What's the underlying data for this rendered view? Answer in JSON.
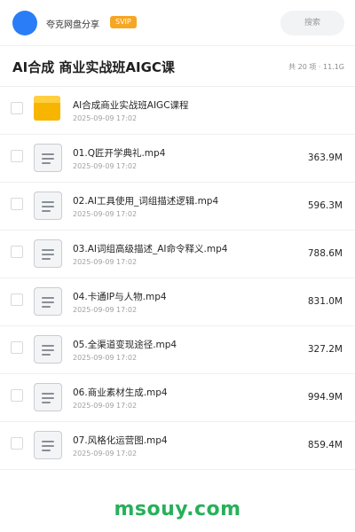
{
  "header": {
    "username": "夸克网盘分享",
    "badge": "SVIP",
    "search_placeholder": "搜索"
  },
  "folder": {
    "title": "AI合成 商业实战班AIGC课",
    "meta": "共 20 项 · 11.1G"
  },
  "items": [
    {
      "type": "folder",
      "name": "AI合成商业实战班AIGC课程",
      "date": "2025-09-09 17:02",
      "size": ""
    },
    {
      "type": "file",
      "name": "01.Q匠开学典礼.mp4",
      "date": "2025-09-09 17:02",
      "size": "363.9M"
    },
    {
      "type": "file",
      "name": "02.AI工具使用_词组描述逻辑.mp4",
      "date": "2025-09-09 17:02",
      "size": "596.3M"
    },
    {
      "type": "file",
      "name": "03.AI词组高级描述_AI命令释义.mp4",
      "date": "2025-09-09 17:02",
      "size": "788.6M"
    },
    {
      "type": "file",
      "name": "04.卡通IP与人物.mp4",
      "date": "2025-09-09 17:02",
      "size": "831.0M"
    },
    {
      "type": "file",
      "name": "05.全渠道变现途径.mp4",
      "date": "2025-09-09 17:02",
      "size": "327.2M"
    },
    {
      "type": "file",
      "name": "06.商业素材生成.mp4",
      "date": "2025-09-09 17:02",
      "size": "994.9M"
    },
    {
      "type": "file",
      "name": "07.风格化运营图.mp4",
      "date": "2025-09-09 17:02",
      "size": "859.4M"
    }
  ],
  "watermark": "msouy.com",
  "colors": {
    "avatar": "#2a7df6",
    "badge": "#f6a623",
    "folder_icon": "#f7b500",
    "watermark": "#27b05a"
  },
  "icons": {
    "folder": "folder-icon",
    "file": "video-file-icon"
  }
}
